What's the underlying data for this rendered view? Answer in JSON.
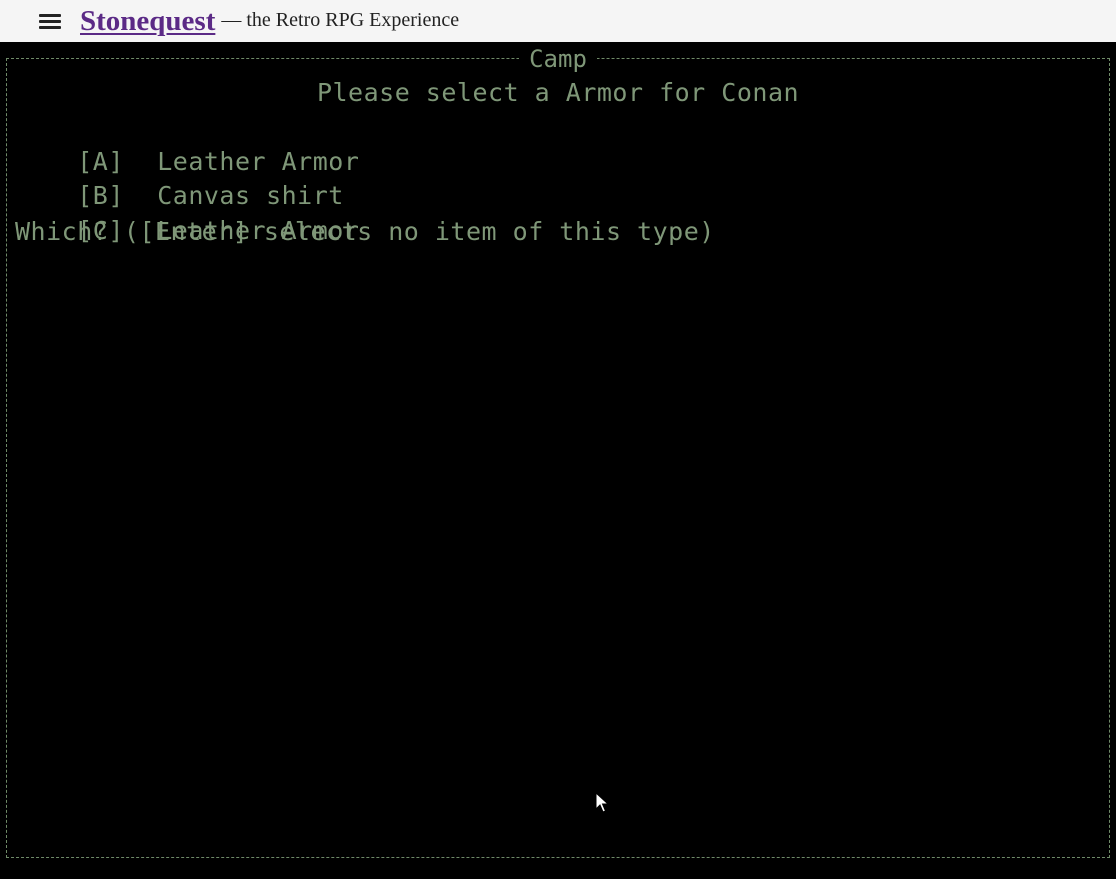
{
  "header": {
    "site_title": "Stonequest",
    "tagline": "— the Retro RPG Experience"
  },
  "terminal": {
    "window_title": "Camp",
    "prompt": "Please select a Armor for Conan",
    "options": [
      {
        "key": "[A]",
        "label": "Leather Armor"
      },
      {
        "key": "[B]",
        "label": "Canvas shirt"
      },
      {
        "key": "[C]",
        "label": "Leather Armor"
      }
    ],
    "question": "Which? ([Enter] selects no item of this type)",
    "text_color": "#7f9778",
    "background_color": "#000000"
  }
}
